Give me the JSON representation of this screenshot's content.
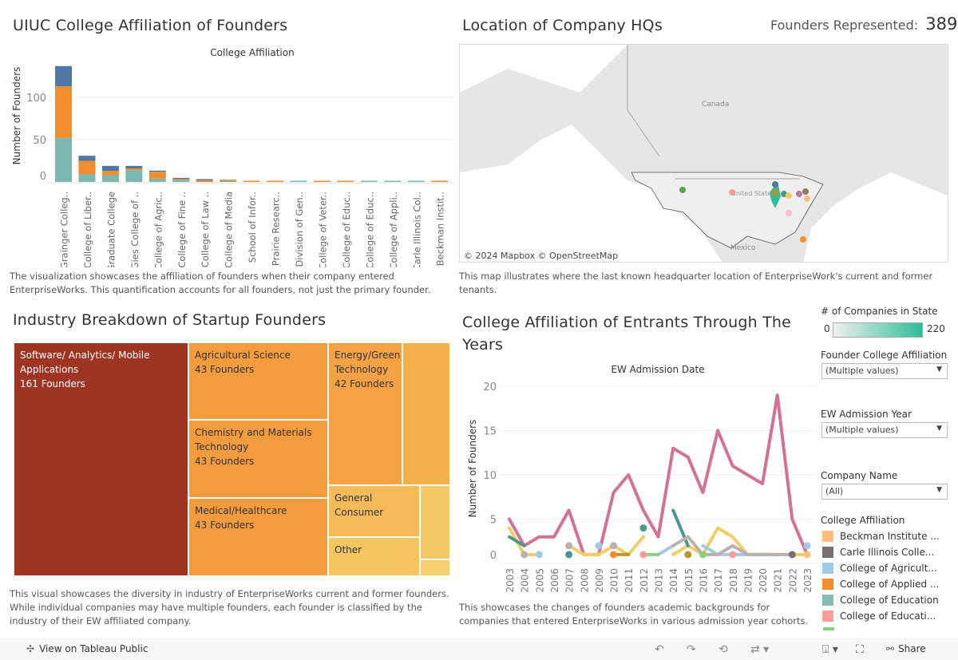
{
  "founders_represented": {
    "label": "Founders Represented:",
    "value": "389"
  },
  "college_panel": {
    "title": "UIUC College Affiliation of Founders",
    "caption": "The visualization showcases the affiliation of founders when their company entered EnterpriseWorks. This quantification accounts for all founders, not just the primary founder."
  },
  "map_panel": {
    "title": "Location of Company HQs",
    "labels": {
      "canada": "Canada",
      "us": "United States",
      "mexico": "Mexico"
    },
    "attribution": "© 2024 Mapbox  © OpenStreetMap",
    "caption": "This map illustrates where the last known headquarter location of EnterpriseWork's current and former tenants."
  },
  "industry_panel": {
    "title": "Industry Breakdown of Startup Founders",
    "tiles": [
      {
        "name": "Software/ Analytics/ Mobile Applications",
        "count": "161 Founders",
        "color": "#9e3523"
      },
      {
        "name": "Agricultural Science",
        "count": "43 Founders",
        "color": "#f29c3e"
      },
      {
        "name": "Chemistry and Materials Technology",
        "count": "43 Founders",
        "color": "#f29c3e"
      },
      {
        "name": "Medical/Healthcare",
        "count": "43 Founders",
        "color": "#f29c3e"
      },
      {
        "name": "Energy/Green Technology",
        "count": "42 Founders",
        "color": "#f4a244"
      },
      {
        "name": "General Consumer",
        "count": "",
        "color": "#f5bb59"
      },
      {
        "name": "Other",
        "count": "",
        "color": "#f5c660"
      }
    ],
    "caption": "This visual showcases the diversity in industry of EnterpriseWorks current and former founders. While individual companies may have multiple founders, each founder is classified by the industry of their EW affiliated company."
  },
  "trend_panel": {
    "title": "College Affiliation of Entrants Through The Years",
    "caption": "This showcases the changes of founders academic backgrounds for companies that entered EnterpriseWorks in various admission year cohorts."
  },
  "chart_data": [
    {
      "type": "bar",
      "stacked": true,
      "title": "College Affiliation",
      "ylabel": "Number of Founders",
      "ylim": [
        0,
        140
      ],
      "yticks": [
        0,
        50,
        100
      ],
      "grid": true,
      "categories": [
        "Grainger Colleg..",
        "College of Liber..",
        "Graduate College",
        "Gies College of ..",
        "College of Agric..",
        "College of Fine ..",
        "College of Law ..",
        "College of Media",
        "School of Infor..",
        "Prairie Researc..",
        "Division of Gen..",
        "College of Veter..",
        "College of Educ..",
        "College of Educ..",
        "College of Appli..",
        "Carle Illinois Col..",
        "Beckman Instit.."
      ],
      "series": [
        {
          "color": "#7ab8b0",
          "values": [
            52,
            9,
            8,
            14,
            4,
            2,
            0,
            0.5,
            0,
            0,
            1,
            0,
            0,
            1,
            1,
            1,
            0
          ]
        },
        {
          "color": "#f28e2b",
          "values": [
            61,
            16,
            5,
            2,
            8,
            1,
            2,
            1,
            1,
            1,
            0,
            1,
            1,
            0,
            0,
            0,
            1
          ]
        },
        {
          "color": "#4e79a7",
          "values": [
            24,
            6,
            6,
            3,
            1,
            1,
            1,
            0,
            0,
            0,
            0,
            0,
            0,
            0,
            0,
            0,
            0
          ]
        }
      ]
    },
    {
      "type": "line",
      "title": "EW Admission Date",
      "ylabel": "Number of Founders",
      "ylim": [
        0,
        20
      ],
      "yticks": [
        0,
        5,
        10,
        15,
        20
      ],
      "grid": true,
      "x": [
        2003,
        2004,
        2005,
        2006,
        2007,
        2008,
        2009,
        2010,
        2011,
        2012,
        2013,
        2014,
        2015,
        2016,
        2017,
        2018,
        2019,
        2020,
        2021,
        2022,
        2023
      ],
      "series": [
        {
          "color": "#d37295",
          "values": [
            5,
            2,
            3,
            3,
            6,
            1,
            1,
            8,
            10,
            6,
            3,
            13,
            12,
            8,
            15,
            11,
            10,
            9,
            19,
            5,
            1
          ]
        },
        {
          "color": "#f1ce63",
          "values": [
            4,
            1,
            1,
            null,
            2,
            1,
            1,
            2,
            1,
            3,
            null,
            1,
            2,
            1,
            4,
            3,
            1,
            1,
            1,
            1,
            1
          ]
        },
        {
          "color": "#499894",
          "values": [
            3,
            2,
            null,
            null,
            1,
            null,
            null,
            null,
            null,
            4,
            null,
            6,
            2,
            null,
            null,
            null,
            null,
            null,
            null,
            null,
            null
          ]
        },
        {
          "color": "#a0cbe8",
          "values": [
            null,
            null,
            1,
            null,
            null,
            null,
            2,
            null,
            null,
            null,
            1,
            2,
            null,
            2,
            1,
            1,
            1,
            1,
            1,
            null,
            2
          ]
        },
        {
          "color": "#bab0ac",
          "values": [
            null,
            1,
            null,
            null,
            2,
            null,
            null,
            2,
            null,
            null,
            null,
            2,
            3,
            1,
            1,
            2,
            1,
            1,
            1,
            1,
            null
          ]
        },
        {
          "color": "#b6992d",
          "values": [
            null,
            null,
            null,
            null,
            null,
            null,
            null,
            1,
            1,
            null,
            null,
            null,
            1,
            null,
            null,
            null,
            null,
            null,
            null,
            null,
            null
          ]
        },
        {
          "color": "#8cd17d",
          "values": [
            null,
            null,
            null,
            null,
            null,
            null,
            null,
            null,
            null,
            1,
            1,
            null,
            null,
            1,
            null,
            null,
            null,
            null,
            null,
            null,
            null
          ]
        },
        {
          "color": "#f28e2b",
          "values": [
            null,
            null,
            null,
            null,
            null,
            null,
            null,
            1,
            null,
            null,
            null,
            null,
            null,
            null,
            null,
            null,
            null,
            null,
            null,
            null,
            null
          ]
        },
        {
          "color": "#ff9d9a",
          "values": [
            null,
            null,
            null,
            null,
            null,
            null,
            null,
            null,
            null,
            1,
            null,
            null,
            null,
            null,
            null,
            1,
            null,
            null,
            null,
            null,
            null
          ]
        },
        {
          "color": "#79706e",
          "values": [
            null,
            null,
            null,
            null,
            null,
            null,
            null,
            null,
            null,
            null,
            null,
            null,
            null,
            null,
            null,
            null,
            null,
            null,
            null,
            1,
            null
          ]
        },
        {
          "color": "#ffbe7d",
          "values": [
            null,
            null,
            null,
            null,
            null,
            null,
            null,
            null,
            null,
            null,
            null,
            null,
            null,
            null,
            null,
            null,
            null,
            null,
            null,
            null,
            1
          ]
        }
      ]
    }
  ],
  "filters": {
    "color_scale": {
      "title": "# of Companies in State",
      "min": "0",
      "max": "220",
      "from": "#f0f0f0",
      "to": "#2ebd96"
    },
    "founder_college": {
      "label": "Founder College Affiliation",
      "value": "(Multiple values)"
    },
    "admission_year": {
      "label": "EW Admission Year",
      "value": "(Multiple values)"
    },
    "company_name": {
      "label": "Company Name",
      "value": "(All)"
    }
  },
  "legend": {
    "title": "College Affiliation",
    "items": [
      {
        "label": "Beckman Institute ...",
        "color": "#ffbe7d"
      },
      {
        "label": "Carle Illinois Colle...",
        "color": "#79706e"
      },
      {
        "label": "College of Agricult...",
        "color": "#a0cbe8"
      },
      {
        "label": "College of Applied ...",
        "color": "#f28e2b"
      },
      {
        "label": "College of Education",
        "color": "#86bcb6"
      },
      {
        "label": "College of Educati...",
        "color": "#ff9d9a"
      }
    ]
  },
  "toolbar": {
    "view_on": "View on Tableau Public",
    "share": "Share"
  }
}
